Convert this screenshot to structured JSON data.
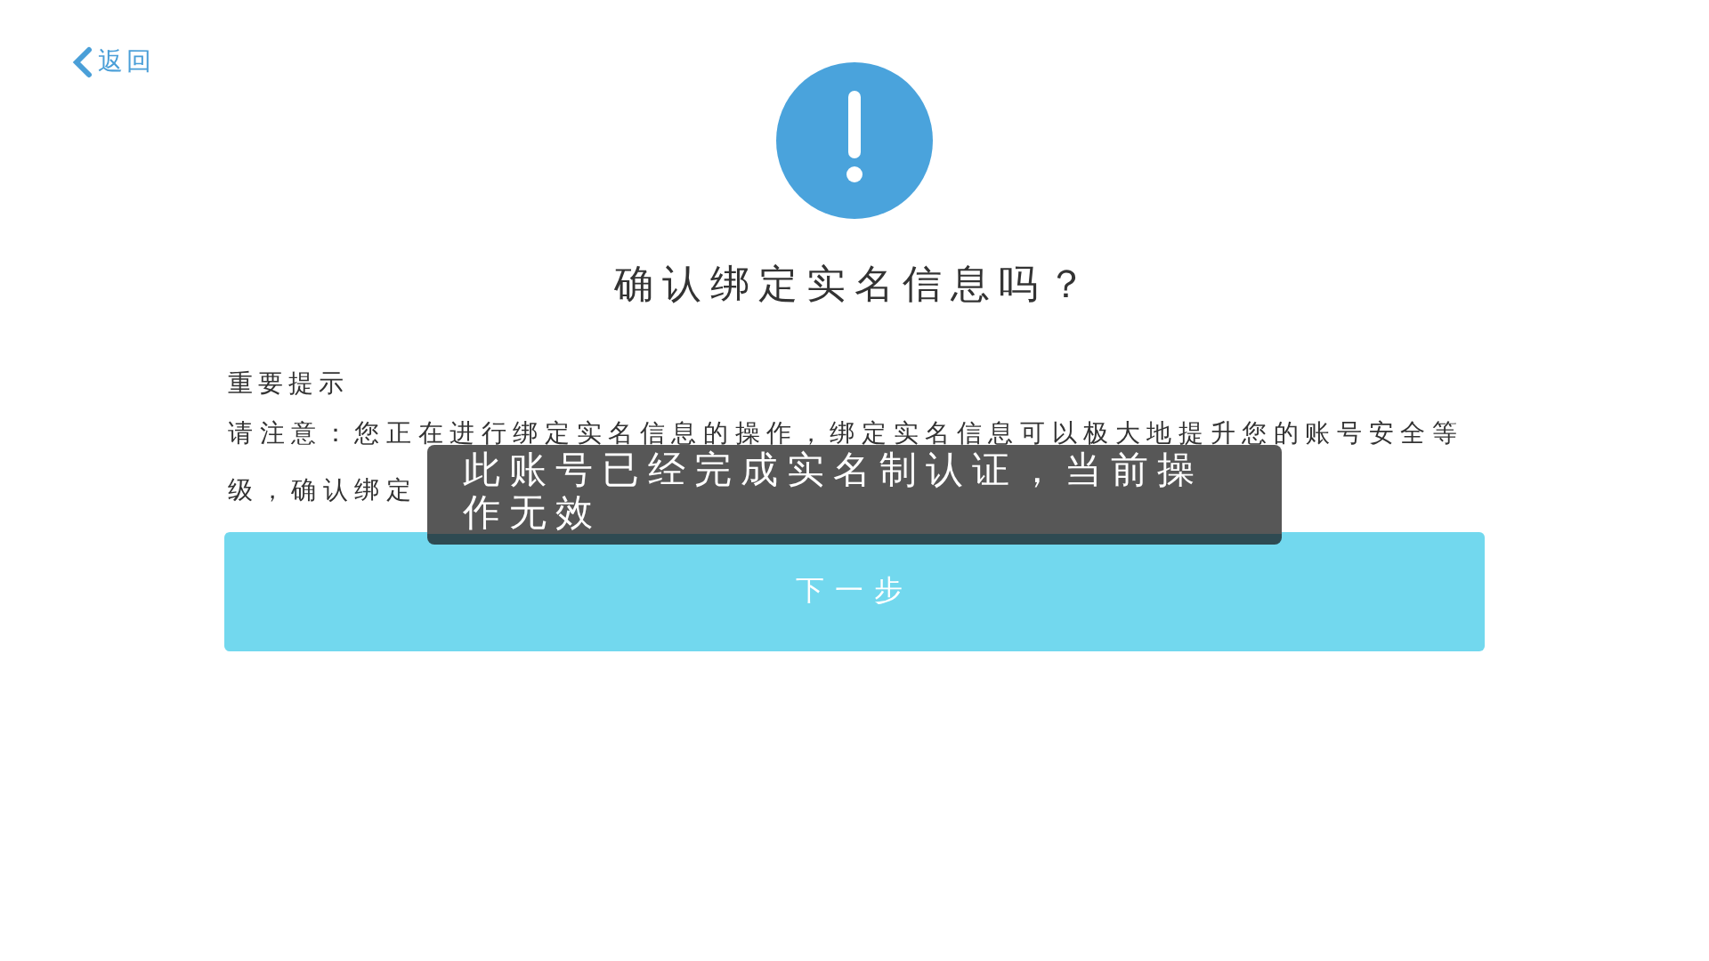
{
  "back_link": {
    "label": "返回"
  },
  "title": "确认绑定实名信息吗？",
  "notice": {
    "heading": "重要提示",
    "lines": [
      "请注意：您正在进行绑定实名信息的操作，绑定实名信息可以极大地提升您的账号安全等",
      "级，确认绑定"
    ]
  },
  "next_button": {
    "label": "下一步"
  },
  "toast": {
    "message": "此账号已经完成实名制认证，当前操作无效"
  }
}
